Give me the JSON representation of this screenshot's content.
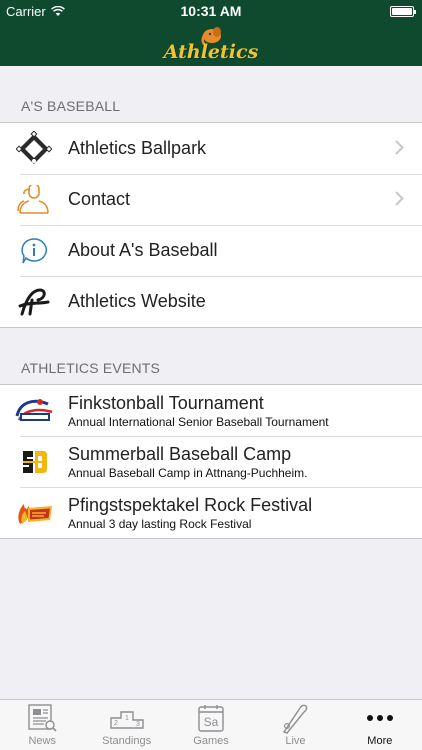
{
  "status": {
    "carrier": "Carrier",
    "time": "10:31 AM",
    "battery_level": 1.0
  },
  "nav": {
    "logo_text": "Athletics"
  },
  "sections": [
    {
      "header": "A'S BASEBALL",
      "items": [
        {
          "label": "Athletics Ballpark",
          "icon": "baseball-diamond-icon",
          "chevron": true
        },
        {
          "label": "Contact",
          "icon": "contacts-icon",
          "chevron": true
        },
        {
          "label": "About A's Baseball",
          "icon": "info-icon",
          "chevron": false
        },
        {
          "label": "Athletics Website",
          "icon": "athletics-logo-icon",
          "chevron": false
        }
      ]
    },
    {
      "header": "ATHLETICS EVENTS",
      "items": [
        {
          "title": "Finkstonball Tournament",
          "subtitle": "Annual International Senior Baseball Tournament",
          "icon": "finkstonball-logo-icon"
        },
        {
          "title": "Summerball Baseball Camp",
          "subtitle": "Annual Baseball Camp in Attnang-Puchheim.",
          "icon": "summerball-logo-icon"
        },
        {
          "title": "Pfingstspektakel Rock Festival",
          "subtitle": "Annual 3 day lasting Rock Festival",
          "icon": "pfingstspektakel-logo-icon"
        }
      ]
    }
  ],
  "tabbar": {
    "tabs": [
      {
        "label": "News",
        "icon": "news-icon",
        "active": false
      },
      {
        "label": "Standings",
        "icon": "podium-icon",
        "active": false
      },
      {
        "label": "Games",
        "icon": "calendar-icon",
        "calendar_text": "Sa",
        "active": false
      },
      {
        "label": "Live",
        "icon": "bat-icon",
        "active": false
      },
      {
        "label": "More",
        "icon": "more-dots-icon",
        "active": true
      }
    ]
  },
  "colors": {
    "nav_bg": "#0f4a2e",
    "logo_gold": "#f2c230",
    "accent_orange": "#e98a2b",
    "info_blue": "#2a7fc1"
  }
}
